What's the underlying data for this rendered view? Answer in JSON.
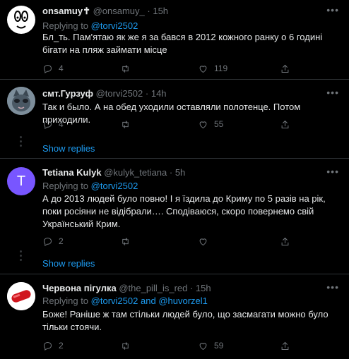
{
  "tweets": [
    {
      "name": "onsamuy✝",
      "handle": "@onsamuy_",
      "time": "· 15h",
      "replying_to_label": "Replying to",
      "replying_to": "@torvi2502",
      "text": "Бл_ть. Пам'ятаю як же я за бався в 2012 кожного ранку о 6 годині бігати на пляж займати місце",
      "replies": "4",
      "retweets": "",
      "likes": "119"
    },
    {
      "name": "смт.Гурзуф",
      "handle": "@torvi2502",
      "time": "· 14h",
      "text": "Так и было. А на обед уходили оставляли полотенце. Потом приходили.",
      "replies": "4",
      "retweets": "",
      "likes": "55",
      "show_replies": "Show replies"
    },
    {
      "name": "Tetiana Kulyk",
      "handle": "@kulyk_tetiana",
      "time": "· 5h",
      "avatar_letter": "T",
      "replying_to_label": "Replying to",
      "replying_to": "@torvi2502",
      "text": "А до 2013 людей було повно! І я їздила до Криму по 5 разів на рік, поки росіяни не відібрали…. Сподіваюся, скоро повернемо свій Український Крим.",
      "replies": "2",
      "retweets": "",
      "likes": "",
      "show_replies": "Show replies"
    },
    {
      "name": "Червона пігулка",
      "handle": "@the_pill_is_red",
      "time": "· 15h",
      "replying_to_label": "Replying to",
      "replying_to": "@torvi2502",
      "and_label": "and",
      "replying_to_2": "@huvorzel1",
      "text": "Боже! Раніше ж там стільки людей було, що засмагати можно було тільки стоячи.",
      "replies": "2",
      "retweets": "",
      "likes": "59"
    }
  ],
  "colors": {
    "background": "#000000",
    "link": "#1d9bf0",
    "muted": "#71767b",
    "divider": "#2f3336",
    "avatar_tetiana": "#7856ff"
  }
}
